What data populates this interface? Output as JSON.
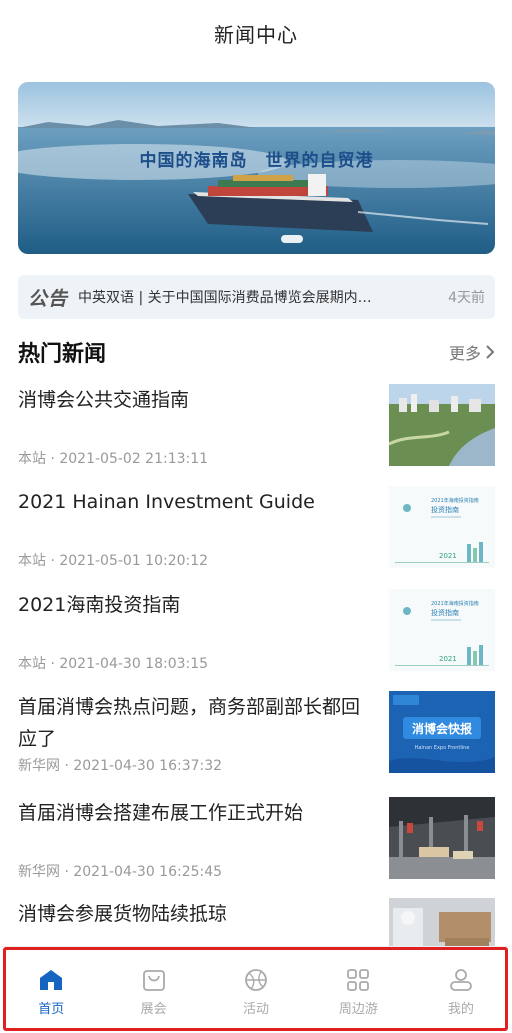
{
  "header": {
    "title": "新闻中心"
  },
  "banner": {
    "caption": "中国的海南岛　世界的自贸港"
  },
  "notice": {
    "tag": "公告",
    "text": "中英双语 | 关于中国国际消费品博览会展期内…",
    "time": "4天前"
  },
  "hot_news": {
    "title": "热门新闻",
    "more": "更多"
  },
  "news": [
    {
      "title": "消博会公共交通指南",
      "source": "本站",
      "time": "2021-05-02 21:13:11"
    },
    {
      "title": "2021 Hainan Investment Guide",
      "source": "本站",
      "time": "2021-05-01 10:20:12"
    },
    {
      "title": "2021海南投资指南",
      "source": "本站",
      "time": "2021-04-30 18:03:15"
    },
    {
      "title": "首届消博会热点问题，商务部副部长都回应了",
      "source": "新华网",
      "time": "2021-04-30 16:37:32"
    },
    {
      "title": "首届消博会搭建布展工作正式开始",
      "source": "新华网",
      "time": "2021-04-30 16:25:45"
    },
    {
      "title": "消博会参展货物陆续抵琼",
      "source": "",
      "time": ""
    }
  ],
  "thumb_text": {
    "guide_title": "2021年海南投资指南",
    "guide_sub": "投资指南",
    "guide_year": "2021",
    "expo_main": "消博会快报",
    "expo_sub": "Hainan Expo Frontline"
  },
  "tabbar": [
    {
      "label": "首页",
      "icon": "home-icon",
      "active": true
    },
    {
      "label": "展会",
      "icon": "bag-icon",
      "active": false
    },
    {
      "label": "活动",
      "icon": "ball-icon",
      "active": false
    },
    {
      "label": "周边游",
      "icon": "grid-icon",
      "active": false
    },
    {
      "label": "我的",
      "icon": "user-icon",
      "active": false
    }
  ],
  "colors": {
    "accent": "#1565c0",
    "inactive": "#aaaaaa",
    "highlight_frame": "#e02020"
  }
}
